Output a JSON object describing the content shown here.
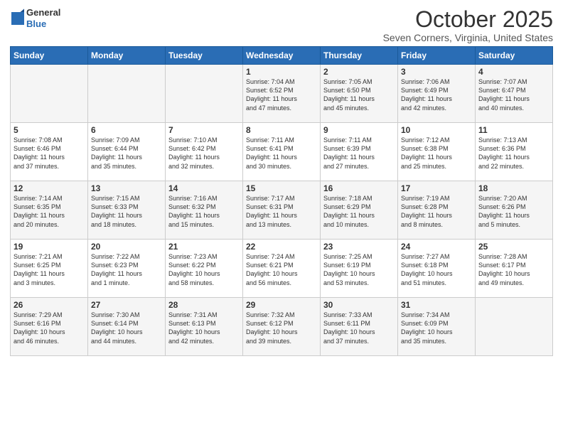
{
  "header": {
    "logo_line1": "General",
    "logo_line2": "Blue",
    "month": "October 2025",
    "location": "Seven Corners, Virginia, United States"
  },
  "days_of_week": [
    "Sunday",
    "Monday",
    "Tuesday",
    "Wednesday",
    "Thursday",
    "Friday",
    "Saturday"
  ],
  "weeks": [
    [
      {
        "num": "",
        "info": ""
      },
      {
        "num": "",
        "info": ""
      },
      {
        "num": "",
        "info": ""
      },
      {
        "num": "1",
        "info": "Sunrise: 7:04 AM\nSunset: 6:52 PM\nDaylight: 11 hours\nand 47 minutes."
      },
      {
        "num": "2",
        "info": "Sunrise: 7:05 AM\nSunset: 6:50 PM\nDaylight: 11 hours\nand 45 minutes."
      },
      {
        "num": "3",
        "info": "Sunrise: 7:06 AM\nSunset: 6:49 PM\nDaylight: 11 hours\nand 42 minutes."
      },
      {
        "num": "4",
        "info": "Sunrise: 7:07 AM\nSunset: 6:47 PM\nDaylight: 11 hours\nand 40 minutes."
      }
    ],
    [
      {
        "num": "5",
        "info": "Sunrise: 7:08 AM\nSunset: 6:46 PM\nDaylight: 11 hours\nand 37 minutes."
      },
      {
        "num": "6",
        "info": "Sunrise: 7:09 AM\nSunset: 6:44 PM\nDaylight: 11 hours\nand 35 minutes."
      },
      {
        "num": "7",
        "info": "Sunrise: 7:10 AM\nSunset: 6:42 PM\nDaylight: 11 hours\nand 32 minutes."
      },
      {
        "num": "8",
        "info": "Sunrise: 7:11 AM\nSunset: 6:41 PM\nDaylight: 11 hours\nand 30 minutes."
      },
      {
        "num": "9",
        "info": "Sunrise: 7:11 AM\nSunset: 6:39 PM\nDaylight: 11 hours\nand 27 minutes."
      },
      {
        "num": "10",
        "info": "Sunrise: 7:12 AM\nSunset: 6:38 PM\nDaylight: 11 hours\nand 25 minutes."
      },
      {
        "num": "11",
        "info": "Sunrise: 7:13 AM\nSunset: 6:36 PM\nDaylight: 11 hours\nand 22 minutes."
      }
    ],
    [
      {
        "num": "12",
        "info": "Sunrise: 7:14 AM\nSunset: 6:35 PM\nDaylight: 11 hours\nand 20 minutes."
      },
      {
        "num": "13",
        "info": "Sunrise: 7:15 AM\nSunset: 6:33 PM\nDaylight: 11 hours\nand 18 minutes."
      },
      {
        "num": "14",
        "info": "Sunrise: 7:16 AM\nSunset: 6:32 PM\nDaylight: 11 hours\nand 15 minutes."
      },
      {
        "num": "15",
        "info": "Sunrise: 7:17 AM\nSunset: 6:31 PM\nDaylight: 11 hours\nand 13 minutes."
      },
      {
        "num": "16",
        "info": "Sunrise: 7:18 AM\nSunset: 6:29 PM\nDaylight: 11 hours\nand 10 minutes."
      },
      {
        "num": "17",
        "info": "Sunrise: 7:19 AM\nSunset: 6:28 PM\nDaylight: 11 hours\nand 8 minutes."
      },
      {
        "num": "18",
        "info": "Sunrise: 7:20 AM\nSunset: 6:26 PM\nDaylight: 11 hours\nand 5 minutes."
      }
    ],
    [
      {
        "num": "19",
        "info": "Sunrise: 7:21 AM\nSunset: 6:25 PM\nDaylight: 11 hours\nand 3 minutes."
      },
      {
        "num": "20",
        "info": "Sunrise: 7:22 AM\nSunset: 6:23 PM\nDaylight: 11 hours\nand 1 minute."
      },
      {
        "num": "21",
        "info": "Sunrise: 7:23 AM\nSunset: 6:22 PM\nDaylight: 10 hours\nand 58 minutes."
      },
      {
        "num": "22",
        "info": "Sunrise: 7:24 AM\nSunset: 6:21 PM\nDaylight: 10 hours\nand 56 minutes."
      },
      {
        "num": "23",
        "info": "Sunrise: 7:25 AM\nSunset: 6:19 PM\nDaylight: 10 hours\nand 53 minutes."
      },
      {
        "num": "24",
        "info": "Sunrise: 7:27 AM\nSunset: 6:18 PM\nDaylight: 10 hours\nand 51 minutes."
      },
      {
        "num": "25",
        "info": "Sunrise: 7:28 AM\nSunset: 6:17 PM\nDaylight: 10 hours\nand 49 minutes."
      }
    ],
    [
      {
        "num": "26",
        "info": "Sunrise: 7:29 AM\nSunset: 6:16 PM\nDaylight: 10 hours\nand 46 minutes."
      },
      {
        "num": "27",
        "info": "Sunrise: 7:30 AM\nSunset: 6:14 PM\nDaylight: 10 hours\nand 44 minutes."
      },
      {
        "num": "28",
        "info": "Sunrise: 7:31 AM\nSunset: 6:13 PM\nDaylight: 10 hours\nand 42 minutes."
      },
      {
        "num": "29",
        "info": "Sunrise: 7:32 AM\nSunset: 6:12 PM\nDaylight: 10 hours\nand 39 minutes."
      },
      {
        "num": "30",
        "info": "Sunrise: 7:33 AM\nSunset: 6:11 PM\nDaylight: 10 hours\nand 37 minutes."
      },
      {
        "num": "31",
        "info": "Sunrise: 7:34 AM\nSunset: 6:09 PM\nDaylight: 10 hours\nand 35 minutes."
      },
      {
        "num": "",
        "info": ""
      }
    ]
  ]
}
